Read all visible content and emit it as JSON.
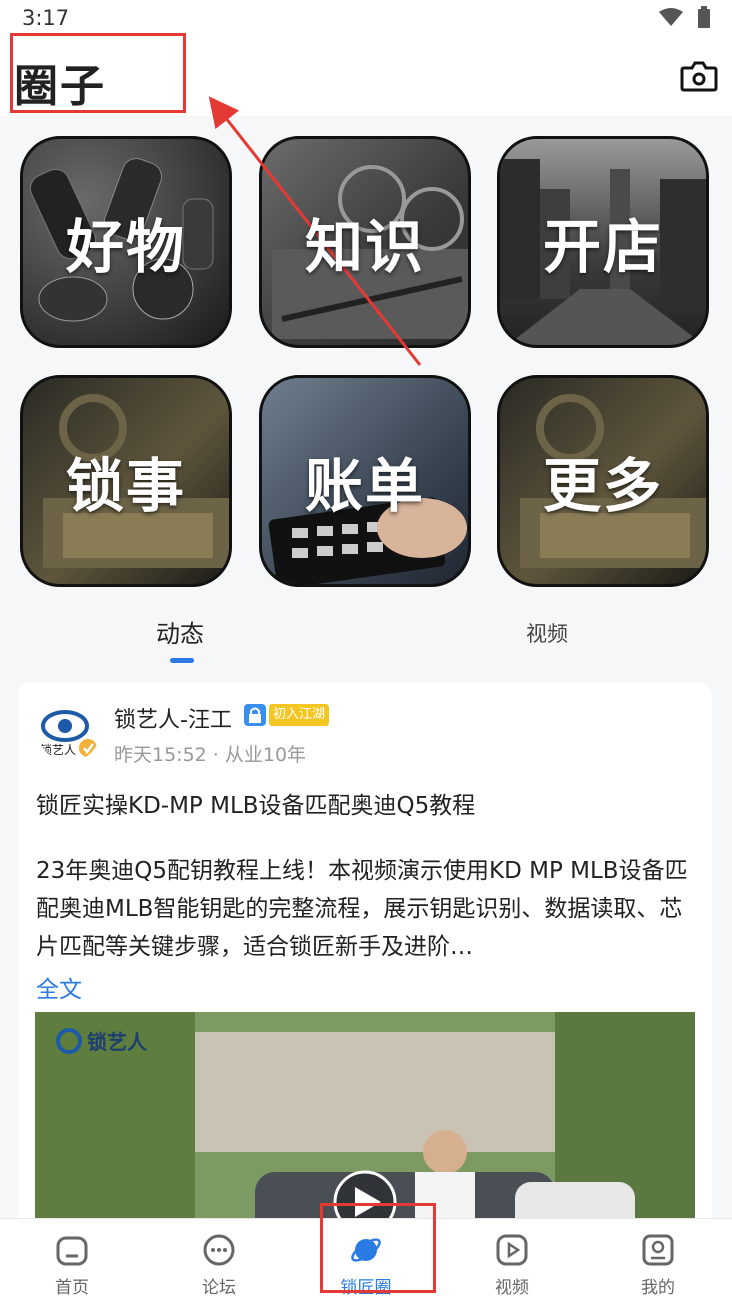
{
  "status_bar": {
    "time": "3:17"
  },
  "header": {
    "title": "圈子"
  },
  "categories": [
    {
      "label": "好物"
    },
    {
      "label": "知识"
    },
    {
      "label": "开店"
    },
    {
      "label": "锁事"
    },
    {
      "label": "账单"
    },
    {
      "label": "更多"
    }
  ],
  "tabs": [
    {
      "label": "动态",
      "active": true
    },
    {
      "label": "视频",
      "active": false
    }
  ],
  "post": {
    "author": "锁艺人-汪工",
    "badge": "初入江湖",
    "meta": "昨天15:52 · 从业10年",
    "title": "锁匠实操KD-MP MLB设备匹配奥迪Q5教程",
    "body": "23年奥迪Q5配钥教程上线！本视频演示使用KD MP MLB设备匹配奥迪MLB智能钥匙的完整流程，展示钥匙识别、数据读取、芯片匹配等关键步骤，适合锁匠新手及进阶…",
    "more": "全文",
    "video_logo": "锁艺人",
    "avatar_text": "锁艺人"
  },
  "bottom_nav": [
    {
      "label": "首页",
      "icon": "home-icon"
    },
    {
      "label": "论坛",
      "icon": "chat-icon"
    },
    {
      "label": "锁匠圈",
      "icon": "planet-icon",
      "active": true
    },
    {
      "label": "视频",
      "icon": "video-icon"
    },
    {
      "label": "我的",
      "icon": "profile-icon"
    }
  ],
  "colors": {
    "accent": "#2a7be4",
    "annotation": "#e53935",
    "badge": "#f3c623"
  }
}
